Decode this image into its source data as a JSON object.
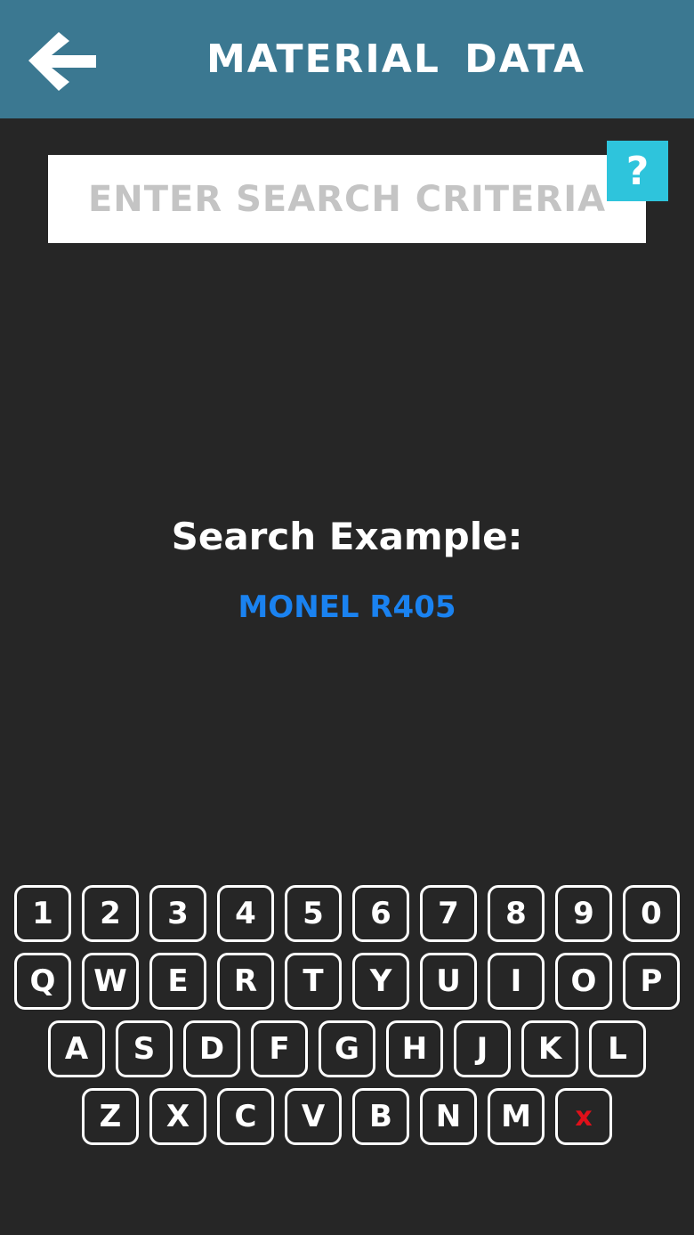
{
  "header": {
    "title": "MATERIAL DATA",
    "back_icon": "arrow-left-icon",
    "background_color": "#3b7891"
  },
  "search": {
    "placeholder": "ENTER SEARCH CRITERIA",
    "value": "",
    "help_label": "?",
    "help_color": "#2ec4dc"
  },
  "example": {
    "label": "Search Example:",
    "value": "MONEL R405",
    "value_color": "#1a82f0"
  },
  "keyboard": {
    "row1": [
      "1",
      "2",
      "3",
      "4",
      "5",
      "6",
      "7",
      "8",
      "9",
      "0"
    ],
    "row2": [
      "Q",
      "W",
      "E",
      "R",
      "T",
      "Y",
      "U",
      "I",
      "O",
      "P"
    ],
    "row3": [
      "A",
      "S",
      "D",
      "F",
      "G",
      "H",
      "J",
      "K",
      "L"
    ],
    "row4": [
      "Z",
      "X",
      "C",
      "V",
      "B",
      "N",
      "M"
    ],
    "delete_label": "x",
    "delete_color": "#e0101a"
  }
}
